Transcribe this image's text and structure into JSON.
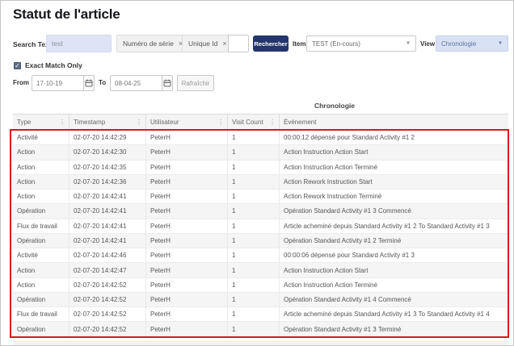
{
  "page": {
    "title": "Statut de l'article"
  },
  "filters": {
    "search_label": "Search Text",
    "search_value": "test",
    "chips": [
      {
        "label": "Numéro de série",
        "close": "×"
      },
      {
        "label": "Unique Id",
        "close": "×"
      }
    ],
    "search_button": "Rechercher",
    "items_label": "Items",
    "items_value": "TEST (En-cours)",
    "view_label": "View",
    "view_value": "Chronologie",
    "exact_match_label": "Exact Match Only",
    "checkbox_checked": "✓",
    "from_label": "From",
    "from_value": "17-10-19",
    "to_label": "To",
    "to_value": "08-04-25",
    "refresh_button": "Rafraîchir"
  },
  "table": {
    "title": "Chronologie",
    "columns": [
      "Type",
      "Timestamp",
      "Utilisateur",
      "Visit Count",
      "Événement"
    ],
    "kebab_icon": "⋮",
    "rows": [
      [
        "Activité",
        "02-07-20 14:42:29",
        "PeterH",
        "1",
        "00:00:12 dépensé pour Standard Activity #1 2"
      ],
      [
        "Action",
        "02-07-20 14:42:30",
        "PeterH",
        "1",
        "Action Instruction Action Start"
      ],
      [
        "Action",
        "02-07-20 14:42:35",
        "PeterH",
        "1",
        "Action Instruction Action Terminé"
      ],
      [
        "Action",
        "02-07-20 14:42:36",
        "PeterH",
        "1",
        "Action Rework Instruction Start"
      ],
      [
        "Action",
        "02-07-20 14:42:41",
        "PeterH",
        "1",
        "Action Rework Instruction Terminé"
      ],
      [
        "Opération",
        "02-07-20 14:42:41",
        "PeterH",
        "1",
        "Opération Standard Activity #1 3 Commencé"
      ],
      [
        "Flux de travail",
        "02-07-20 14:42:41",
        "PeterH",
        "1",
        "Article acheminé depuis Standard Activity #1 2 To Standard Activity #1 3"
      ],
      [
        "Opération",
        "02-07-20 14:42:41",
        "PeterH",
        "1",
        "Opération Standard Activity #1 2 Terminé"
      ],
      [
        "Activité",
        "02-07-20 14:42:46",
        "PeterH",
        "1",
        "00:00:06 dépensé pour Standard Activity #1 3"
      ],
      [
        "Action",
        "02-07-20 14:42:47",
        "PeterH",
        "1",
        "Action Instruction Action Start"
      ],
      [
        "Action",
        "02-07-20 14:42:52",
        "PeterH",
        "1",
        "Action Instruction Action Terminé"
      ],
      [
        "Opération",
        "02-07-20 14:42:52",
        "PeterH",
        "1",
        "Opération Standard Activity #1 4 Commencé"
      ],
      [
        "Flux de travail",
        "02-07-20 14:42:52",
        "PeterH",
        "1",
        "Article acheminé depuis Standard Activity #1 3 To Standard Activity #1 4"
      ],
      [
        "Opération",
        "02-07-20 14:42:52",
        "PeterH",
        "1",
        "Opération Standard Activity #1 3 Terminé"
      ]
    ]
  },
  "colors": {
    "accent_navy": "#24356b",
    "light_blue_field": "#dee4f5",
    "view_select_bg": "#d9e2f4",
    "annotation_red": "#e0161c",
    "header_row_bg": "#f4f4f4",
    "alt_row_bg": "#f5f5f5"
  }
}
